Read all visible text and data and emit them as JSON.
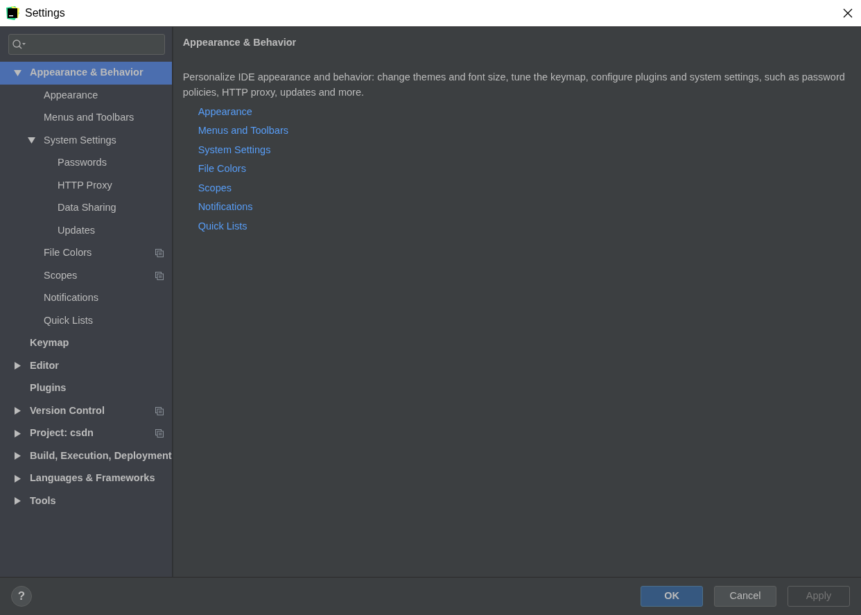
{
  "window": {
    "title": "Settings"
  },
  "tree": [
    {
      "label": "Appearance & Behavior",
      "selected": true,
      "expanded": true,
      "children": [
        {
          "label": "Appearance",
          "selected": false
        },
        {
          "label": "Menus and Toolbars",
          "selected": false
        },
        {
          "label": "System Settings",
          "selected": false,
          "expanded": true,
          "children": [
            {
              "label": "Passwords",
              "selected": false
            },
            {
              "label": "HTTP Proxy",
              "selected": false
            },
            {
              "label": "Data Sharing",
              "selected": false
            },
            {
              "label": "Updates",
              "selected": false
            }
          ]
        },
        {
          "label": "File Colors",
          "selected": false,
          "project_level": true
        },
        {
          "label": "Scopes",
          "selected": false,
          "project_level": true
        },
        {
          "label": "Notifications",
          "selected": false
        },
        {
          "label": "Quick Lists",
          "selected": false
        }
      ]
    },
    {
      "label": "Keymap",
      "selected": false
    },
    {
      "label": "Editor",
      "selected": false,
      "expanded": false
    },
    {
      "label": "Plugins",
      "selected": false
    },
    {
      "label": "Version Control",
      "selected": false,
      "expanded": false,
      "project_level": true
    },
    {
      "label": "Project: csdn",
      "selected": false,
      "expanded": false,
      "project_level": true
    },
    {
      "label": "Build, Execution, Deployment",
      "selected": false,
      "expanded": false
    },
    {
      "label": "Languages & Frameworks",
      "selected": false,
      "expanded": false
    },
    {
      "label": "Tools",
      "selected": false,
      "expanded": false
    }
  ],
  "content": {
    "title": "Appearance & Behavior",
    "description": "Personalize IDE appearance and behavior: change themes and font size, tune the keymap, configure plugins and system settings, such as password policies, HTTP proxy, updates and more.",
    "links": [
      "Appearance",
      "Menus and Toolbars",
      "System Settings",
      "File Colors",
      "Scopes",
      "Notifications",
      "Quick Lists"
    ]
  },
  "footer": {
    "help": "?",
    "buttons": [
      {
        "label": "OK",
        "kind": "default",
        "disabled": false
      },
      {
        "label": "Cancel",
        "kind": "normal",
        "disabled": false
      },
      {
        "label": "Apply",
        "kind": "normal",
        "disabled": true
      }
    ]
  }
}
